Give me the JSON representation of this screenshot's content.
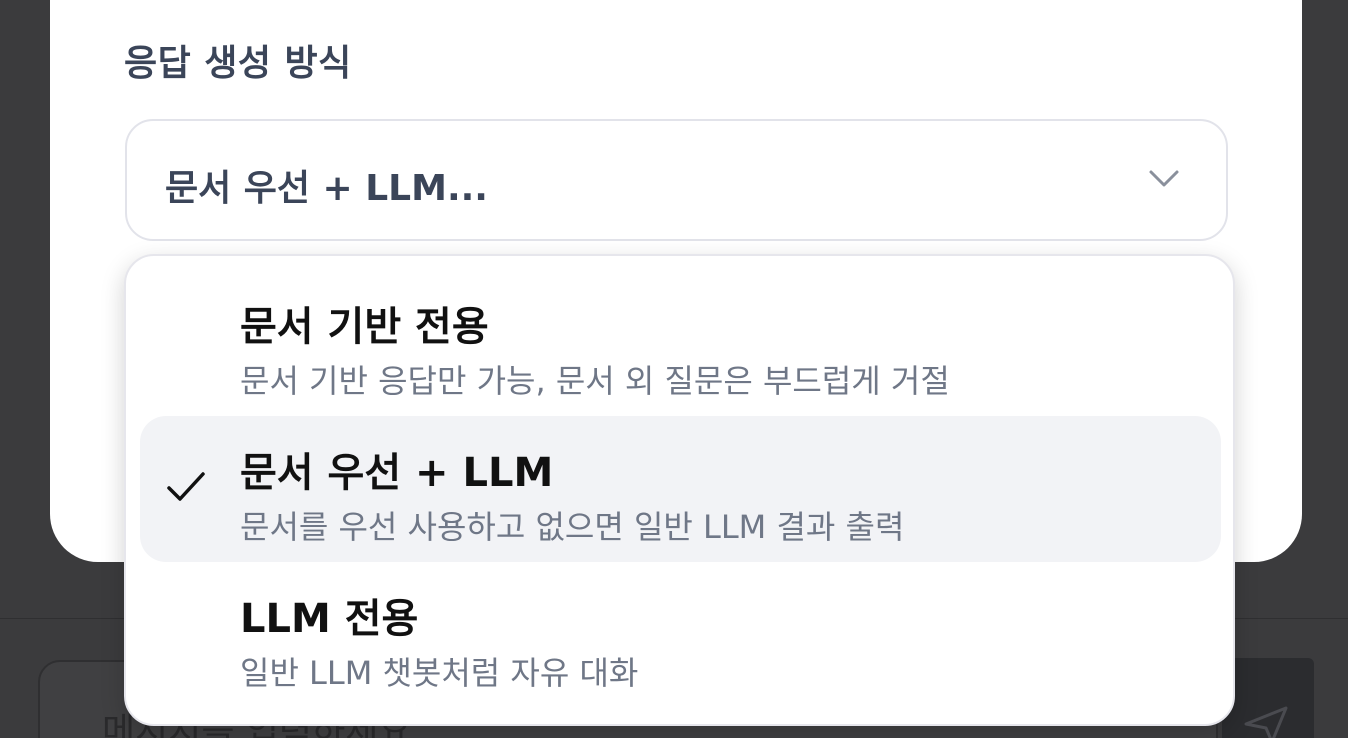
{
  "background": {
    "input_placeholder": "메시지를 입력하세요",
    "send_icon": "send-icon"
  },
  "modal": {
    "field_label": "응답 생성 방식",
    "select": {
      "value": "문서 우선 + LLM...",
      "chevron_icon": "chevron-down-icon"
    },
    "menu": {
      "options": [
        {
          "title": "문서 기반 전용",
          "description": "문서 기반 응답만 가능, 문서 외 질문은 부드럽게 거절",
          "selected": false
        },
        {
          "title": "문서 우선 + LLM",
          "description": "문서를 우선 사용하고 없으면 일반 LLM 결과 출력",
          "selected": true
        },
        {
          "title": "LLM 전용",
          "description": "일반 LLM 챗봇처럼 자유 대화",
          "selected": false
        }
      ]
    }
  },
  "colors": {
    "overlay": "#3b3b3d",
    "card": "#ffffff",
    "label_text": "#3b4559",
    "selected_option_bg": "#f2f3f6",
    "description_text": "#6f7787"
  }
}
